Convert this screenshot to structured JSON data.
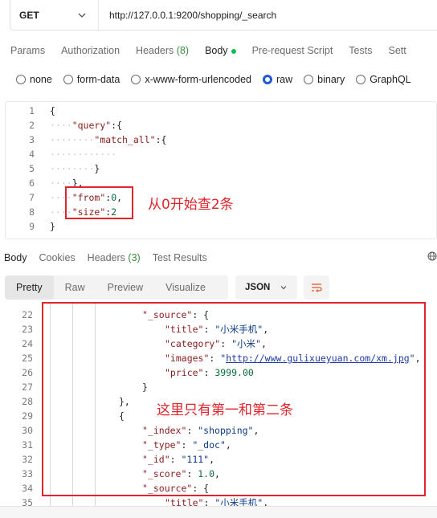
{
  "request": {
    "method": "GET",
    "url": "http://127.0.0.1:9200/shopping/_search"
  },
  "request_tabs": [
    {
      "label": "Params"
    },
    {
      "label": "Authorization"
    },
    {
      "label": "Headers",
      "count": "(8)"
    },
    {
      "label": "Body",
      "active": true
    },
    {
      "label": "Pre-request Script"
    },
    {
      "label": "Tests"
    },
    {
      "label": "Sett"
    }
  ],
  "body_types": [
    {
      "label": "none"
    },
    {
      "label": "form-data"
    },
    {
      "label": "x-www-form-urlencoded"
    },
    {
      "label": "raw",
      "checked": true
    },
    {
      "label": "binary"
    },
    {
      "label": "GraphQL"
    }
  ],
  "request_body": {
    "line_numbers": [
      "1",
      "2",
      "3",
      "4",
      "5",
      "6",
      "7",
      "8",
      "9"
    ],
    "lines": [
      {
        "text": "{"
      },
      {
        "key": "\"query\"",
        "text": ":{"
      },
      {
        "key": "\"match_all\"",
        "text": ":{"
      },
      {
        "text": ""
      },
      {
        "text": "}"
      },
      {
        "text": "},"
      },
      {
        "key": "\"from\"",
        "text": ":",
        "num": "0",
        "tail": ","
      },
      {
        "key": "\"size\"",
        "text": ":",
        "num": "2"
      },
      {
        "text": "}"
      }
    ]
  },
  "annotations": {
    "request": "从0开始查2条",
    "response": "这里只有第一和第二条"
  },
  "response_tabs": [
    {
      "label": "Body"
    },
    {
      "label": "Cookies"
    },
    {
      "label": "Headers",
      "count": "(3)"
    },
    {
      "label": "Test Results"
    }
  ],
  "response_toolbar": {
    "formats": [
      "Pretty",
      "Raw",
      "Preview",
      "Visualize"
    ],
    "active_format": "Pretty",
    "language": "JSON"
  },
  "response_body": {
    "line_numbers": [
      "22",
      "23",
      "24",
      "25",
      "26",
      "27",
      "28",
      "29",
      "30",
      "31",
      "32",
      "33",
      "34",
      "35"
    ],
    "lines": [
      {
        "key": "\"_source\"",
        "text": ": {"
      },
      {
        "key": "\"title\"",
        "text": ": ",
        "str": "\"小米手机\"",
        "tail": ","
      },
      {
        "key": "\"category\"",
        "text": ": ",
        "str": "\"小米\"",
        "tail": ","
      },
      {
        "key": "\"images\"",
        "text": ": ",
        "str_pre": "\"",
        "link": "http://www.gulixueyuan.com/xm.jpg",
        "str_post": "\"",
        "tail": ","
      },
      {
        "key": "\"price\"",
        "text": ": ",
        "num": "3999.00"
      },
      {
        "text": "}"
      },
      {
        "text": "},"
      },
      {
        "text": "{"
      },
      {
        "key": "\"_index\"",
        "text": ": ",
        "str": "\"shopping\"",
        "tail": ","
      },
      {
        "key": "\"_type\"",
        "text": ": ",
        "str": "\"_doc\"",
        "tail": ","
      },
      {
        "key": "\"_id\"",
        "text": ": ",
        "str": "\"111\"",
        "tail": ","
      },
      {
        "key": "\"_score\"",
        "text": ": ",
        "num": "1.0",
        "tail": ","
      },
      {
        "key": "\"_source\"",
        "text": ": {"
      },
      {
        "key": "\"title\"",
        "text": ": ",
        "str": "\"小米手机\"",
        "tail": ","
      }
    ]
  },
  "colors": {
    "accent": "#1f5ad0",
    "highlight": "#e0252b",
    "active_dot": "#0cbb52",
    "key": "#8a1c1c",
    "string": "#0b3a8a",
    "number": "#0b6b3a"
  },
  "icons": [
    "chevron-down-icon",
    "globe-icon",
    "wrap-lines-icon"
  ]
}
